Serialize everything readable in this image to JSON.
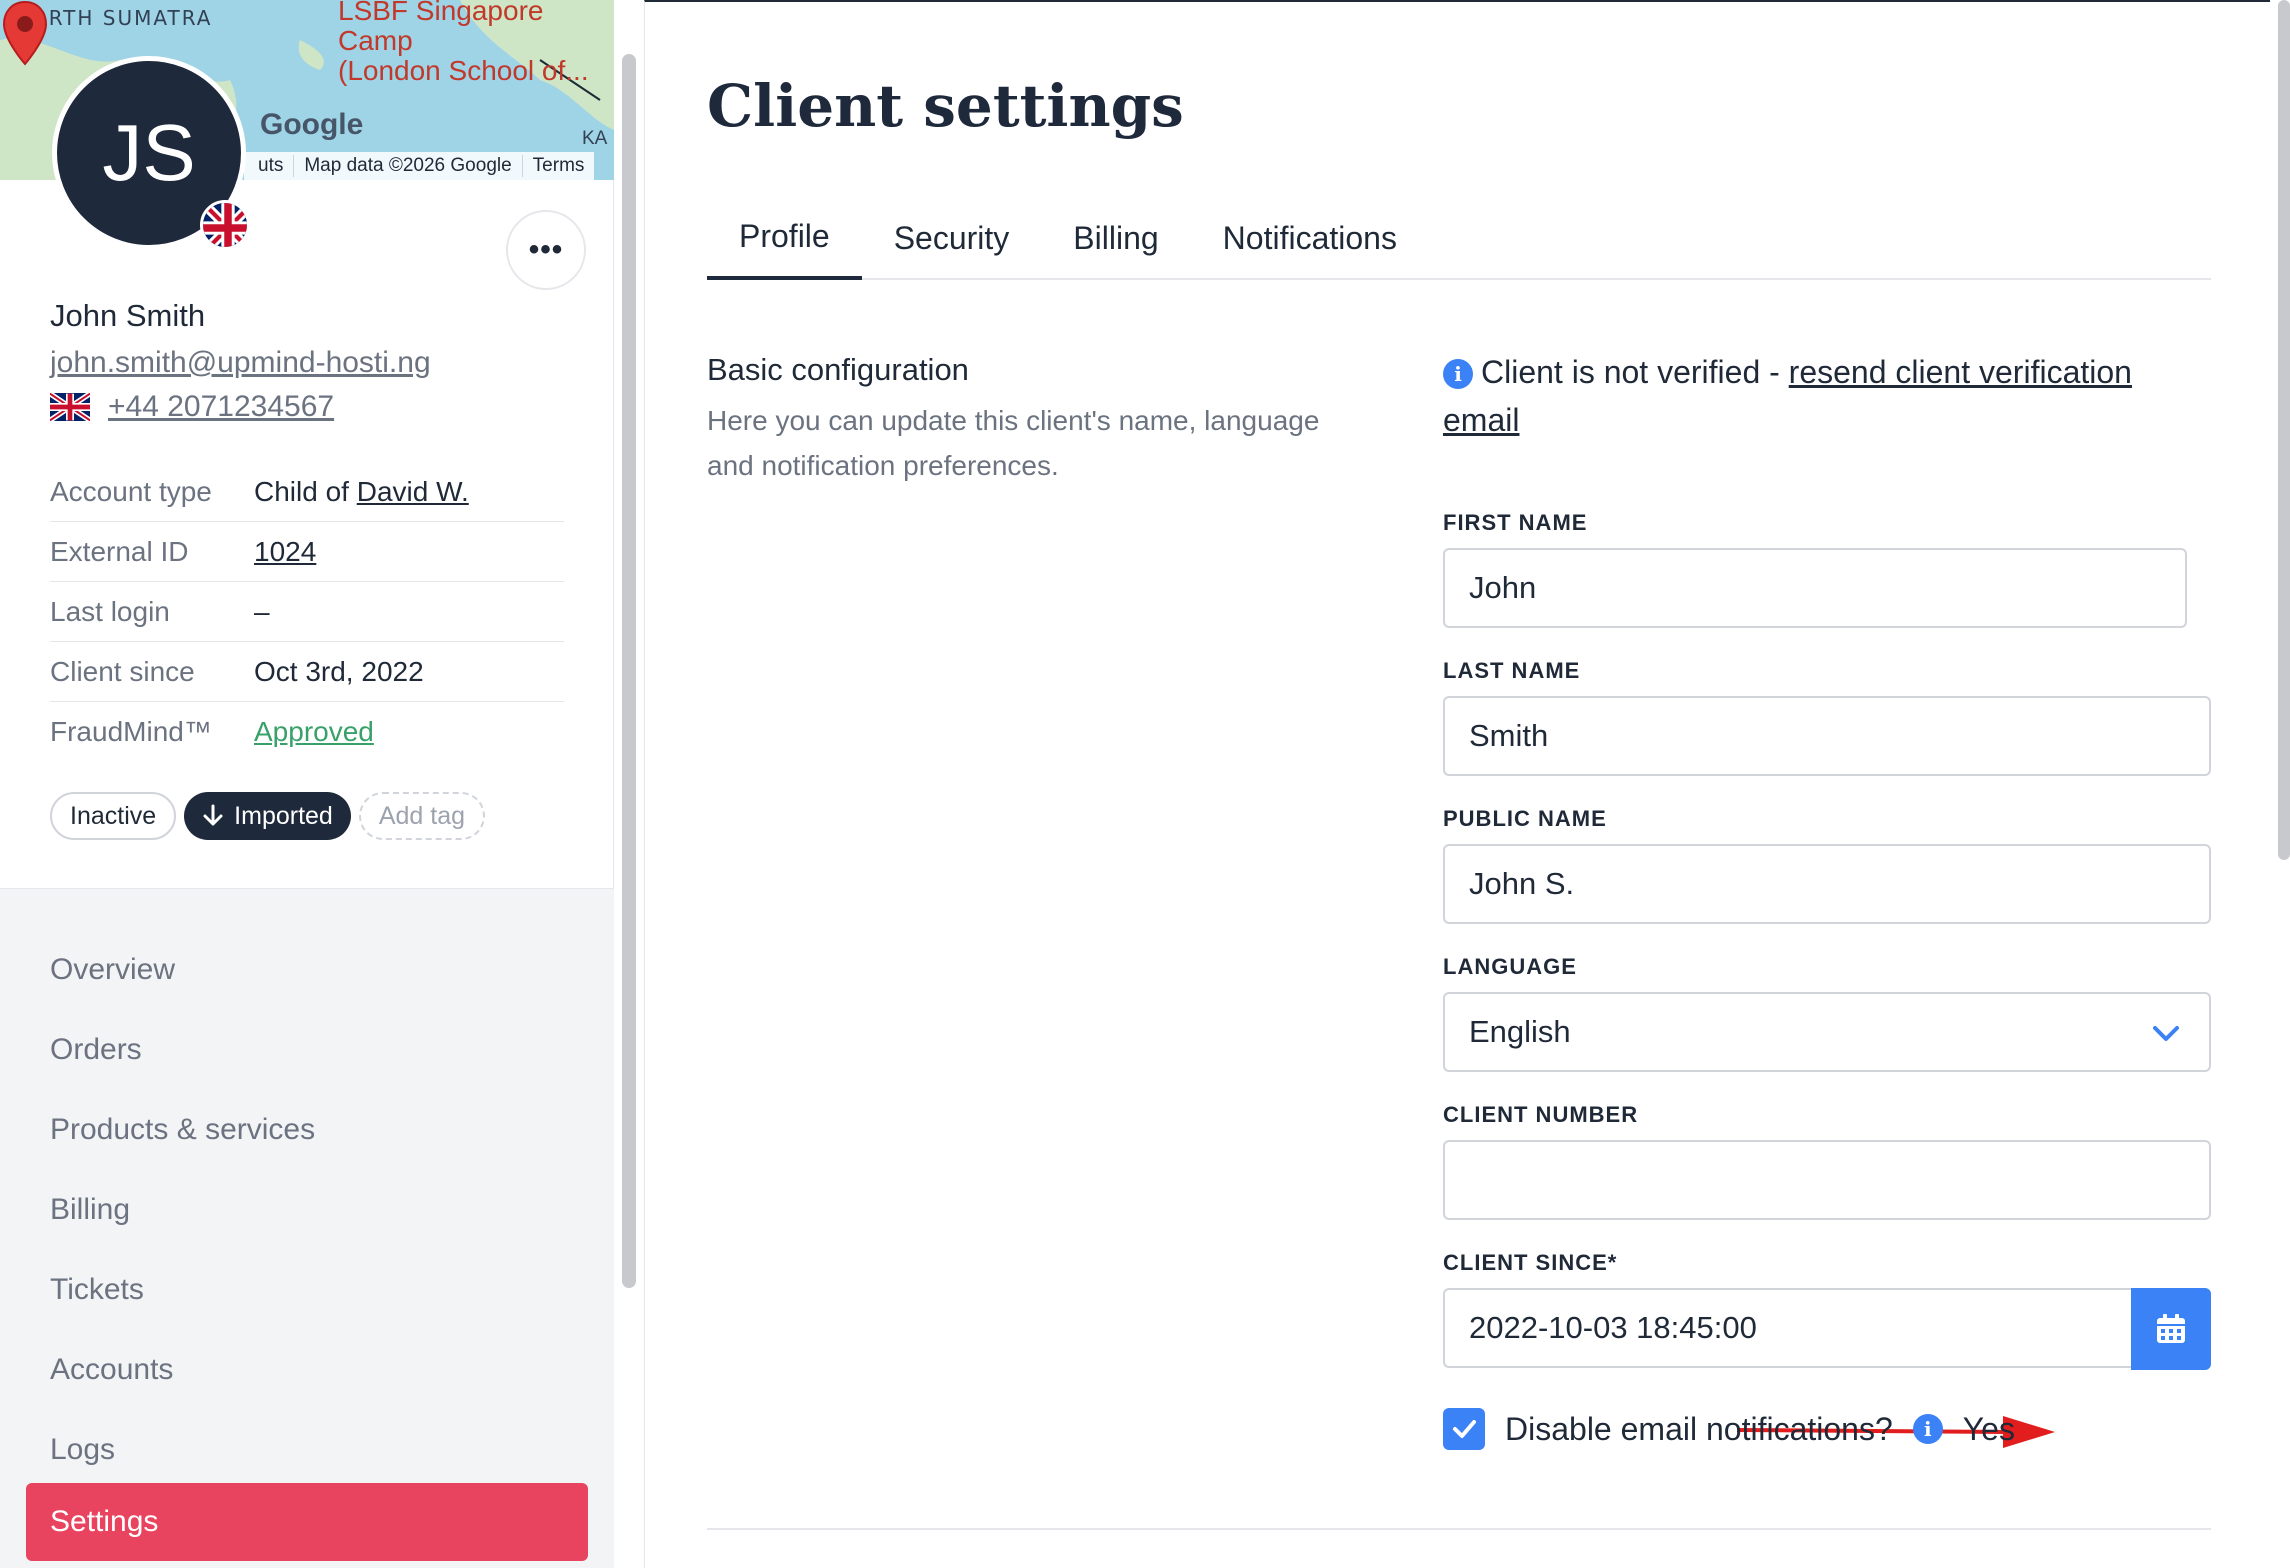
{
  "map": {
    "region_label": "NORTH SUMATRA",
    "place_line1": "LSBF Singapore Camp",
    "place_line2": "(London School of...",
    "corner_label": "KA",
    "google_logo": "Google",
    "attrib_shortcuts": "uts",
    "attrib_data": "Map data ©2026 Google",
    "attrib_terms": "Terms"
  },
  "client": {
    "initials": "JS",
    "name": "John Smith",
    "email": "john.smith@upmind-hosti.ng",
    "phone": "+44 2071234567",
    "details": [
      {
        "key": "Account type",
        "prefix": "Child of ",
        "value": "David W."
      },
      {
        "key": "External ID",
        "value": "1024"
      },
      {
        "key": "Last login",
        "value": "–"
      },
      {
        "key": "Client since",
        "value": "Oct 3rd, 2022"
      },
      {
        "key": "FraudMind™",
        "value": "Approved"
      }
    ],
    "tags": {
      "inactive": "Inactive",
      "imported": "Imported",
      "add": "Add tag"
    }
  },
  "nav": {
    "items": [
      "Overview",
      "Orders",
      "Products & services",
      "Billing",
      "Tickets",
      "Accounts",
      "Logs",
      "Settings"
    ],
    "active": "Settings"
  },
  "main": {
    "title": "Client settings",
    "tabs": [
      "Profile",
      "Security",
      "Billing",
      "Notifications"
    ],
    "active_tab": "Profile",
    "section_title": "Basic configuration",
    "section_desc": "Here you can update this client's name, language and notification preferences.",
    "verify_text": "Client is not verified - ",
    "verify_link": "resend client verification email",
    "fields": {
      "first_name_label": "FIRST NAME",
      "first_name": "John",
      "last_name_label": "LAST NAME",
      "last_name": "Smith",
      "public_name_label": "PUBLIC NAME",
      "public_name": "John S.",
      "language_label": "LANGUAGE",
      "language": "English",
      "client_number_label": "CLIENT NUMBER",
      "client_number": "",
      "client_since_label": "CLIENT SINCE*",
      "client_since": "2022-10-03 18:45:00"
    },
    "disable_email_label": "Disable email notifications?",
    "disable_email_value": "Yes"
  },
  "colors": {
    "accent": "#3b82f6",
    "active_nav": "#e8435f",
    "dark": "#1e293b",
    "approved": "#38a169",
    "annotation_arrow": "#e11d1d"
  }
}
